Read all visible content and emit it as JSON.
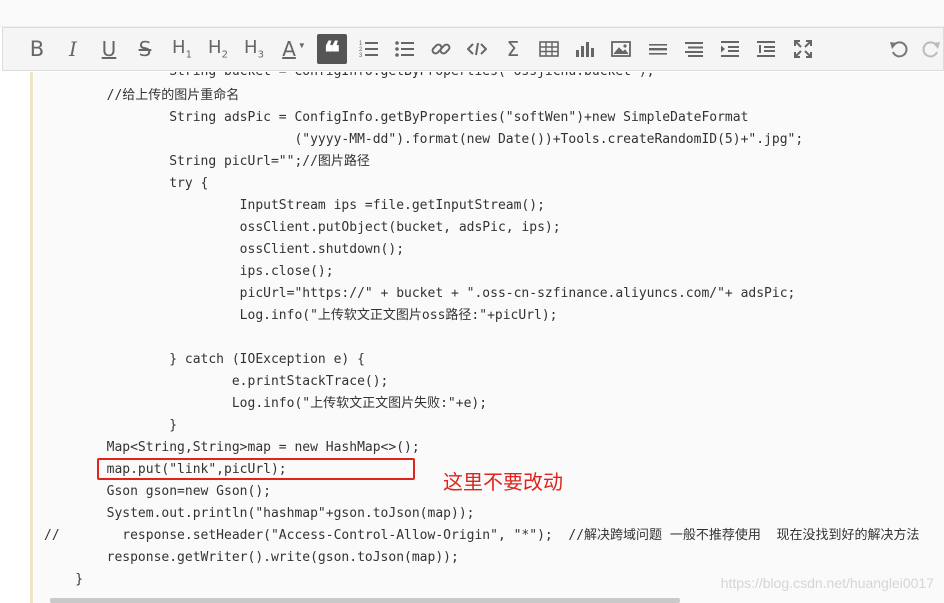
{
  "toolbar": {
    "items": [
      {
        "name": "bold-button",
        "label": "B"
      },
      {
        "name": "italic-button",
        "label": "I"
      },
      {
        "name": "underline-button",
        "label": "U"
      },
      {
        "name": "strikethrough-button",
        "label": "S"
      },
      {
        "name": "heading1-button",
        "label": "H1"
      },
      {
        "name": "heading2-button",
        "label": "H2"
      },
      {
        "name": "heading3-button",
        "label": "H3"
      },
      {
        "name": "text-color-button",
        "label": "A"
      },
      {
        "name": "quote-button",
        "label": "66"
      },
      {
        "name": "ordered-list-button",
        "label": ""
      },
      {
        "name": "unordered-list-button",
        "label": ""
      },
      {
        "name": "link-button",
        "label": ""
      },
      {
        "name": "code-button",
        "label": "</>"
      },
      {
        "name": "formula-button",
        "label": "Σ"
      },
      {
        "name": "table-button",
        "label": ""
      },
      {
        "name": "chart-button",
        "label": ""
      },
      {
        "name": "image-button",
        "label": ""
      },
      {
        "name": "horizontal-rule-button",
        "label": ""
      },
      {
        "name": "toc-button",
        "label": ""
      },
      {
        "name": "indent-button",
        "label": ""
      },
      {
        "name": "outdent-button",
        "label": ""
      },
      {
        "name": "fullscreen-button",
        "label": ""
      },
      {
        "name": "undo-button",
        "label": ""
      },
      {
        "name": "redo-button",
        "label": ""
      }
    ]
  },
  "code_lines": [
    "                String bucket = ConfigInfo.getByProperties(\"ossjichu.bucket\");",
    "        //给上传的图片重命名",
    "                String adsPic = ConfigInfo.getByProperties(\"softWen\")+new SimpleDateFormat",
    "                                (\"yyyy-MM-dd\").format(new Date())+Tools.createRandomID(5)+\".jpg\";",
    "                String picUrl=\"\";//图片路径",
    "                try {",
    "                         InputStream ips =file.getInputStream();",
    "                         ossClient.putObject(bucket, adsPic, ips);",
    "                         ossClient.shutdown();",
    "                         ips.close();",
    "                         picUrl=\"https://\" + bucket + \".oss-cn-szfinance.aliyuncs.com/\"+ adsPic;",
    "                         Log.info(\"上传软文正文图片oss路径:\"+picUrl);",
    "",
    "                } catch (IOException e) {",
    "                        e.printStackTrace();",
    "                        Log.info(\"上传软文正文图片失败:\"+e);",
    "                }",
    "        Map<String,String>map = new HashMap<>();",
    "        map.put(\"link\",picUrl);",
    "        Gson gson=new Gson();",
    "        System.out.println(\"hashmap\"+gson.toJson(map));",
    "//        response.setHeader(\"Access-Control-Allow-Origin\", \"*\");  //解决跨域问题 一般不推荐使用  现在没找到好的解决方法",
    "        response.getWriter().write(gson.toJson(map));",
    "    }"
  ],
  "annotation": "这里不要改动",
  "watermark": "https://blog.csdn.net/huanglei0017"
}
